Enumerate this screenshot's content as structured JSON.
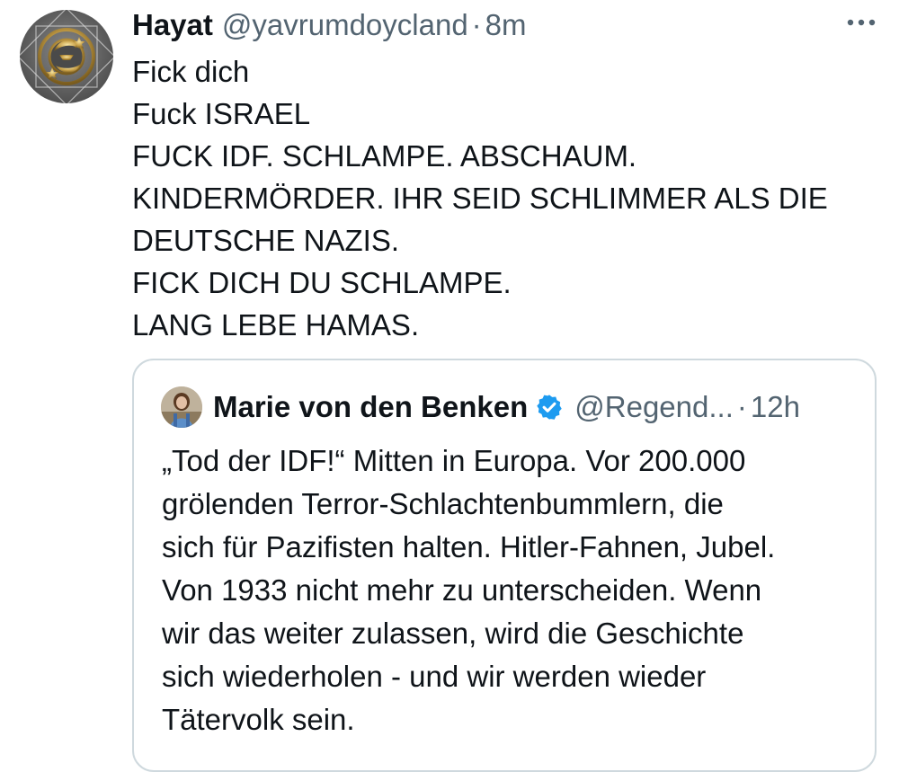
{
  "tweet": {
    "display_name": "Hayat",
    "handle": "@yavrumdoycland",
    "separator": "·",
    "time": "8m",
    "more_icon": "more-horizontal-icon",
    "text_lines": [
      "Fick dich",
      "Fuck ISRAEL",
      "FUCK IDF. SCHLAMPE. ABSCHAUM.",
      "KINDERMÖRDER. IHR SEID SCHLIMMER ALS DIE",
      "DEUTSCHE NAZIS.",
      "FICK DICH DU SCHLAMPE.",
      "LANG LEBE HAMAS."
    ]
  },
  "quoted_tweet": {
    "display_name": "Marie von den Benken",
    "verified_icon": "verified-badge-icon",
    "handle": "@Regend...",
    "separator": "·",
    "time": "12h",
    "text_lines": [
      "„Tod der IDF!“ Mitten in Europa. Vor 200.000",
      "grölenden Terror-Schlachtenbummlern, die",
      "sich für Pazifisten halten. Hitler-Fahnen, Jubel.",
      "Von 1933 nicht mehr zu unterscheiden. Wenn",
      "wir das weiter zulassen, wird die Geschichte",
      "sich wiederholen - und wir werden wieder",
      "Tätervolk sein."
    ]
  },
  "colors": {
    "text_primary": "#0f1419",
    "text_secondary": "#536471",
    "border": "#cfd9de",
    "verified_blue": "#1d9bf0"
  }
}
